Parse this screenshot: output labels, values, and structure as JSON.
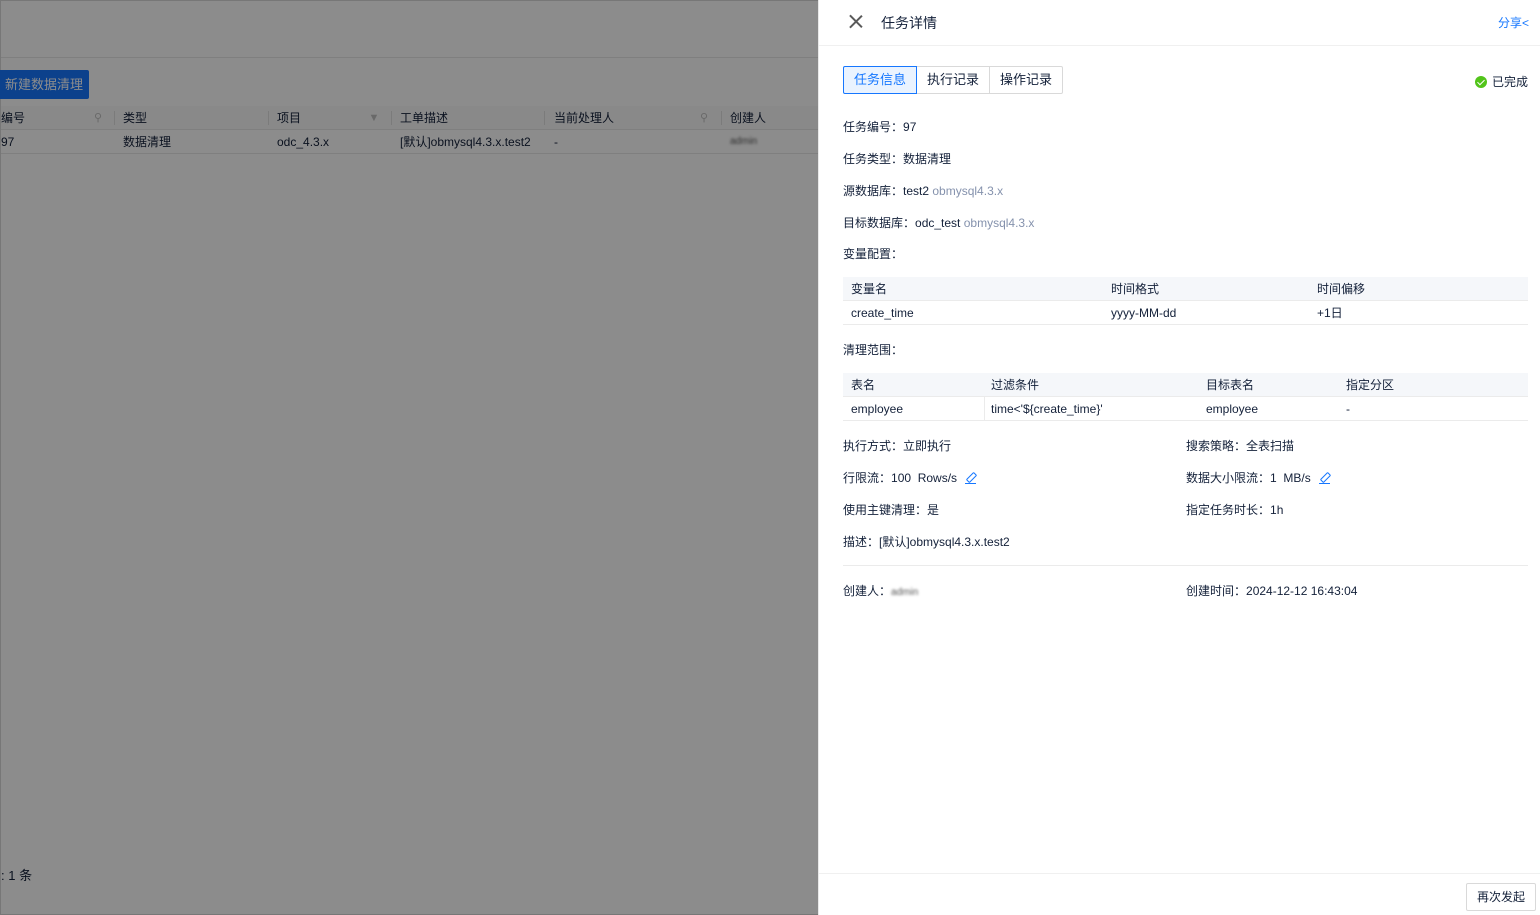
{
  "background": {
    "create_button": "新建数据清理",
    "columns": [
      "编号",
      "类型",
      "项目",
      "工单描述",
      "当前处理人",
      "创建人"
    ],
    "row": [
      "97",
      "数据清理",
      "odc_4.3.x",
      "[默认]obmysql4.3.x.test2",
      "-",
      "admin"
    ],
    "total": ": 1 条"
  },
  "drawer": {
    "title": "任务详情",
    "share": "分享",
    "tabs": [
      "任务信息",
      "执行记录",
      "操作记录"
    ],
    "status": "已完成",
    "status_color": "#52c41a",
    "task_id_label": "任务编号：",
    "task_id": "97",
    "task_type_label": "任务类型：",
    "task_type": "数据清理",
    "source_db_label": "源数据库：",
    "source_db": "test2",
    "source_db_ds": "obmysql4.3.x",
    "target_db_label": "目标数据库：",
    "target_db": "odc_test",
    "target_db_ds": "obmysql4.3.x",
    "variables_label": "变量配置：",
    "variables_table": {
      "headers": [
        "变量名",
        "时间格式",
        "时间偏移"
      ],
      "rows": [
        [
          "create_time",
          "yyyy-MM-dd",
          "+1日"
        ]
      ]
    },
    "scope_label": "清理范围：",
    "scope_table": {
      "headers": [
        "表名",
        "过滤条件",
        "目标表名",
        "指定分区"
      ],
      "rows": [
        [
          "employee",
          "time<'${create_time}'",
          "employee",
          "-"
        ]
      ]
    },
    "exec_mode_label": "执行方式：",
    "exec_mode": "立即执行",
    "search_strategy_label": "搜索策略：",
    "search_strategy": "全表扫描",
    "row_limit_label": "行限流：",
    "row_limit": "100",
    "row_limit_unit": "Rows/s",
    "data_limit_label": "数据大小限流：",
    "data_limit": "1",
    "data_limit_unit": "MB/s",
    "use_pk_label": "使用主键清理：",
    "use_pk": "是",
    "duration_label": "指定任务时长：",
    "duration": "1h",
    "desc_label": "描述：",
    "desc": "[默认]obmysql4.3.x.test2",
    "creator_label": "创建人：",
    "creator": "admin",
    "created_at_label": "创建时间：",
    "created_at": "2024-12-12 16:43:04",
    "relaunch": "再次发起"
  }
}
